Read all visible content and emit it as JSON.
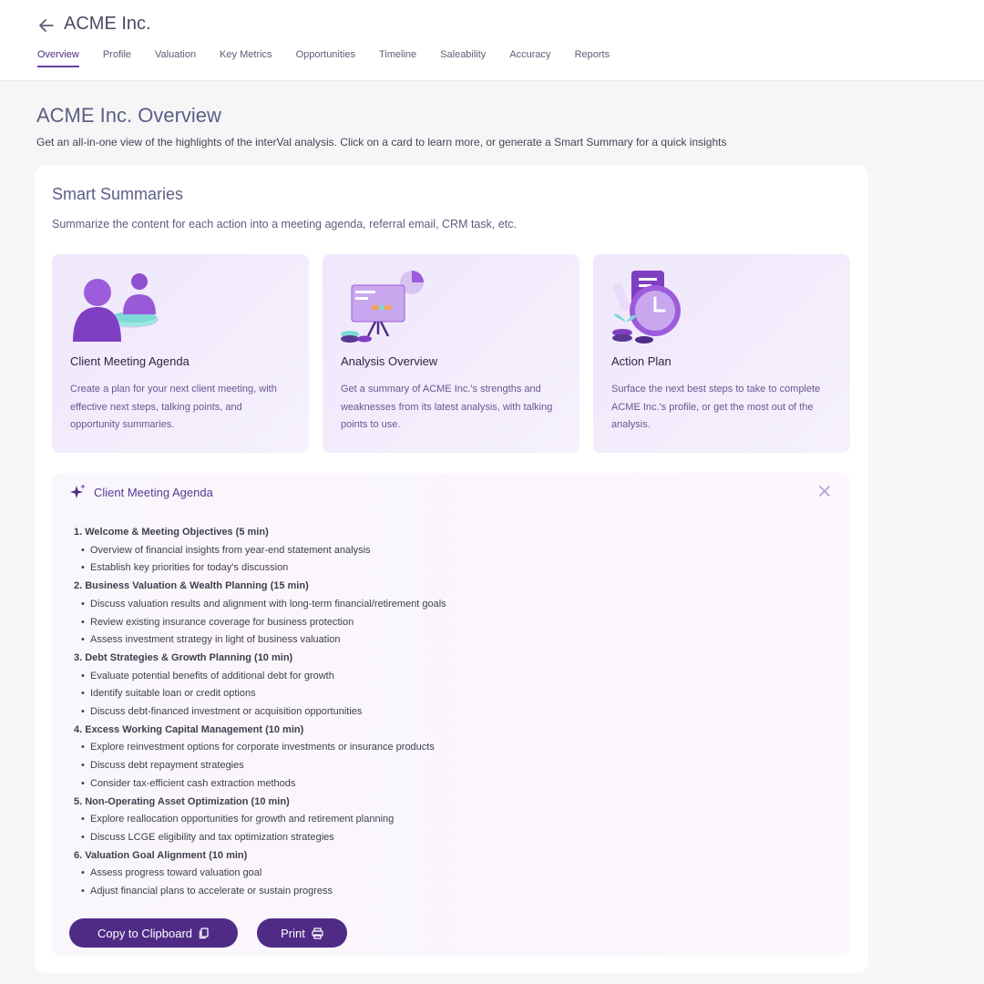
{
  "header": {
    "company": "ACME Inc.",
    "tabs": [
      "Overview",
      "Profile",
      "Valuation",
      "Key Metrics",
      "Opportunities",
      "Timeline",
      "Saleability",
      "Accuracy",
      "Reports"
    ],
    "active_tab": "Overview"
  },
  "page": {
    "title": "ACME Inc. Overview",
    "subtitle": "Get an all-in-one view of the highlights of the interVal analysis. Click on a card to learn more, or generate a Smart Summary for a quick insights"
  },
  "smart_summaries": {
    "title": "Smart Summaries",
    "subtitle": "Summarize the content for each action into a meeting agenda, referral email, CRM task, etc.",
    "cards": [
      {
        "title": "Client Meeting Agenda",
        "description": "Create a plan for your next client meeting, with effective next steps, talking points, and opportunity summaries."
      },
      {
        "title": "Analysis Overview",
        "description": "Get a summary of ACME Inc.'s strengths and weaknesses from its latest analysis, with talking points to use."
      },
      {
        "title": "Action Plan",
        "description": "Surface the next best steps to take to complete ACME Inc.'s profile, or get the most out of the analysis."
      }
    ]
  },
  "agenda": {
    "title": "Client Meeting Agenda",
    "sections": [
      {
        "heading": "1. Welcome & Meeting Objectives (5 min)",
        "items": [
          "Overview of financial insights from year-end statement analysis",
          "Establish key priorities for today's discussion"
        ]
      },
      {
        "heading": "2. Business Valuation & Wealth Planning (15 min)",
        "items": [
          "Discuss valuation results and alignment with long-term financial/retirement goals",
          "Review existing insurance coverage for business protection",
          "Assess investment strategy in light of business valuation"
        ]
      },
      {
        "heading": "3. Debt Strategies & Growth Planning (10 min)",
        "items": [
          "Evaluate potential benefits of additional debt for growth",
          "Identify suitable loan or credit options",
          "Discuss debt-financed investment or acquisition opportunities"
        ]
      },
      {
        "heading": "4. Excess Working Capital Management (10 min)",
        "items": [
          "Explore reinvestment options for corporate investments or insurance products",
          "Discuss debt repayment strategies",
          "Consider tax-efficient cash extraction methods"
        ]
      },
      {
        "heading": "5. Non-Operating Asset Optimization (10 min)",
        "items": [
          "Explore reallocation opportunities for growth and retirement planning",
          "Discuss LCGE eligibility and tax optimization strategies"
        ]
      },
      {
        "heading": "6. Valuation Goal Alignment (10 min)",
        "items": [
          "Assess progress toward valuation goal",
          "Adjust financial plans to accelerate or sustain progress"
        ]
      }
    ],
    "copy_label": "Copy to Clipboard",
    "print_label": "Print"
  },
  "colors": {
    "accent": "#4f2b86",
    "tile_bg": "#efe7fb",
    "title_text": "#5c5e85"
  }
}
